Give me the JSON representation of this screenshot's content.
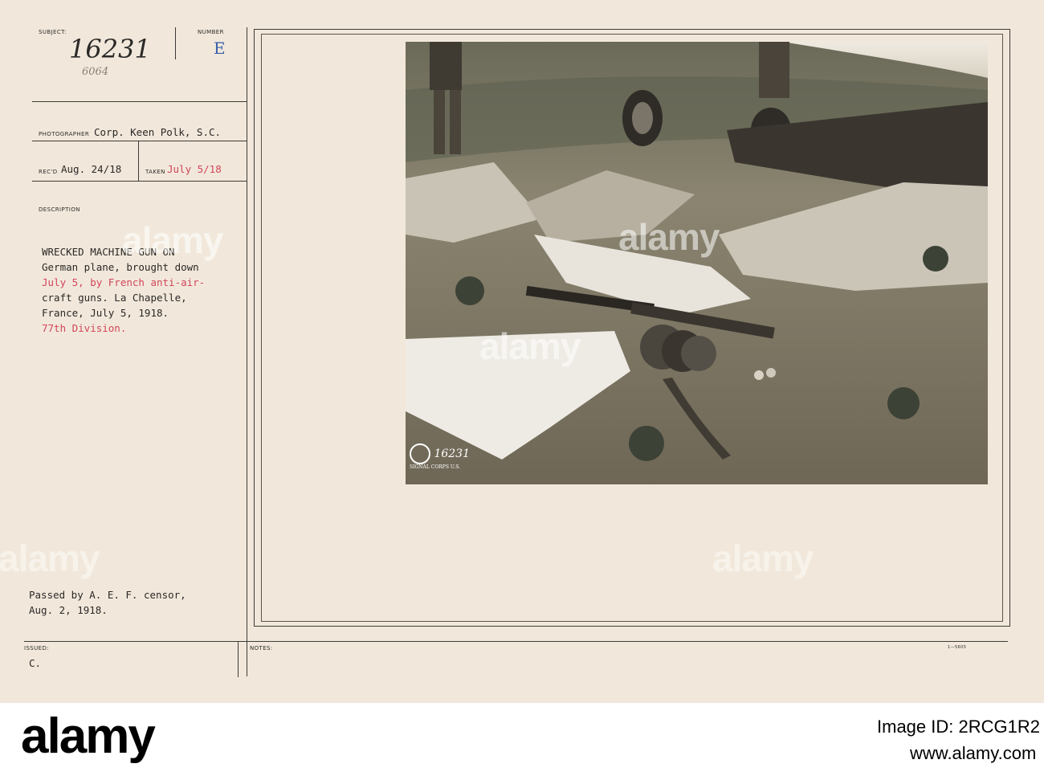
{
  "card": {
    "subject_label": "SUBJECT:",
    "subject_number": "16231",
    "subject_sub": "6064",
    "number_label": "NUMBER",
    "number_value": "E",
    "photographer_label": "PHOTOGRAPHER",
    "photographer_value": "Corp. Keen Polk, S.C.",
    "recd_label": "REC'D",
    "recd_value": "Aug. 24/18",
    "taken_label": "TAKEN",
    "taken_value": "July 5/18",
    "description_label": "DESCRIPTION",
    "description_lines": [
      "WRECKED MACHINE GUN ON",
      "German plane, brought down",
      "July 5, by French anti-air-",
      "craft guns. La Chapelle,",
      "France, July 5, 1918.",
      "77th Division."
    ],
    "censor_lines": [
      "Passed by A. E. F. censor,",
      "Aug. 2, 1918."
    ],
    "issued_label": "ISSUED:",
    "issued_value": "C.",
    "notes_label": "NOTES:",
    "form_code": "1—5605",
    "photo_stamp_number": "16231",
    "photo_stamp_text": "SIGNAL CORPS U.S."
  },
  "colors": {
    "card": "#f1e8db",
    "ink": "#2b2826",
    "red_ink": "#d2455a"
  },
  "watermark": {
    "text": "alamy"
  },
  "footer": {
    "logo": "alamy",
    "image_id": "Image ID: 2RCG1R2",
    "url": "www.alamy.com"
  }
}
